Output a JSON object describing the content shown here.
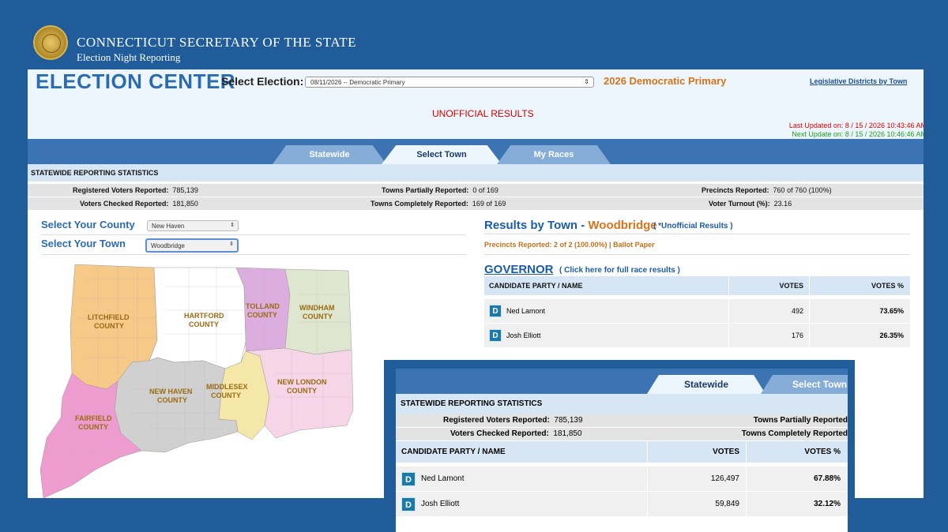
{
  "header": {
    "org_title": "CONNECTICUT SECRETARY OF THE STATE",
    "org_subtitle": "Election Night Reporting",
    "seal_icon": "state-seal-icon"
  },
  "topbar": {
    "app_title": "ELECTION CENTER",
    "select_label": "Select Election:",
    "select_value": "08/11/2026 -- Democratic Primary",
    "election_name": "2026 Democratic Primary",
    "legislative_link": "Legislative Districts by Town",
    "unofficial": "UNOFFICIAL RESULTS",
    "last_updated": "Last Updated on: 8 / 15 / 2026 10:43:46 AM",
    "next_update": "Next Update on: 8 / 15 / 2026 10:46:46 AM"
  },
  "tabs": [
    {
      "label": "Statewide",
      "active": false
    },
    {
      "label": "Select Town",
      "active": true
    },
    {
      "label": "My Races",
      "active": false
    }
  ],
  "stats": {
    "heading": "STATEWIDE REPORTING STATISTICS",
    "registered_label": "Registered Voters Reported:",
    "registered_value": "785,139",
    "checked_label": "Voters Checked Reported:",
    "checked_value": "181,850",
    "towns_partial_label": "Towns Partially Reported:",
    "towns_partial_value": "0 of 169",
    "towns_complete_label": "Towns Completely Reported:",
    "towns_complete_value": "169 of 169",
    "precincts_label": "Precincts Reported:",
    "precincts_value": "760 of 760 (100%)",
    "turnout_label": "Voter Turnout (%):",
    "turnout_value": "23.16"
  },
  "selectors": {
    "county_label": "Select Your County",
    "county_value": "New Haven",
    "town_label": "Select Your Town",
    "town_value": "Woodbridge"
  },
  "map": {
    "counties": [
      "LITCHFIELD COUNTY",
      "HARTFORD COUNTY",
      "TOLLAND COUNTY",
      "WINDHAM COUNTY",
      "NEW HAVEN COUNTY",
      "MIDDLESEX COUNTY",
      "NEW LONDON COUNTY",
      "FAIRFIELD COUNTY"
    ],
    "colors": {
      "litchfield": "#f6c989",
      "hartford": "#ffffff",
      "tolland": "#dcaedf",
      "windham": "#dfe6cf",
      "new_haven": "#d0d0d0",
      "middlesex": "#f5e7a8",
      "new_london": "#f6d5e8",
      "fairfield": "#ee9ccf"
    }
  },
  "results": {
    "title_prefix": "Results by Town - ",
    "town": "Woodbridge",
    "note": "( *Unofficial Results )",
    "precincts_line": "Precincts Reported: 2 of 2 (100.00%)  |  Ballot Paper",
    "race_title": "GOVERNOR",
    "race_link": "( Click here for full race results )",
    "columns": [
      "CANDIDATE PARTY / NAME",
      "VOTES",
      "VOTES %"
    ],
    "rows": [
      {
        "party": "D",
        "name": "Ned Lamont",
        "votes": "492",
        "pct": "73.65%"
      },
      {
        "party": "D",
        "name": "Josh Elliott",
        "votes": "176",
        "pct": "26.35%"
      }
    ]
  },
  "inset": {
    "tabs": [
      {
        "label": "Statewide",
        "active": true
      },
      {
        "label": "Select Town",
        "active": false
      }
    ],
    "heading": "STATEWIDE REPORTING STATISTICS",
    "registered_label": "Registered Voters Reported:",
    "registered_value": "785,139",
    "checked_label": "Voters Checked Reported:",
    "checked_value": "181,850",
    "towns_partial_label": "Towns Partially Reported",
    "towns_complete_label": "Towns Completely Reported",
    "columns": [
      "CANDIDATE PARTY / NAME",
      "VOTES",
      "VOTES %"
    ],
    "rows": [
      {
        "party": "D",
        "name": "Ned Lamont",
        "votes": "126,497",
        "pct": "67.88%"
      },
      {
        "party": "D",
        "name": "Josh Elliott",
        "votes": "59,849",
        "pct": "32.12%"
      }
    ]
  },
  "colors": {
    "background": "#1f5c99",
    "accent_blue": "#2b6cb0",
    "accent_orange": "#d9731a",
    "party_dem": "#1a7aa8"
  }
}
